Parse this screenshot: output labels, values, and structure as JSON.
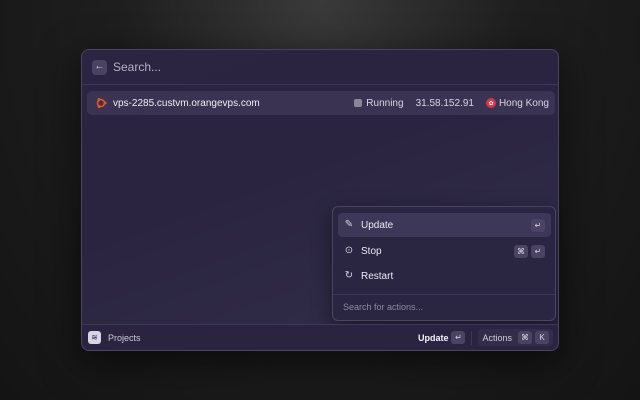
{
  "search": {
    "placeholder": "Search..."
  },
  "server": {
    "name": "vps-2285.custvm.orangevps.com",
    "status": "Running",
    "ip": "31.58.152.91",
    "location": "Hong Kong"
  },
  "actions_panel": {
    "items": [
      {
        "label": "Update",
        "icon": "pencil-icon",
        "shortcut": [
          "↵"
        ]
      },
      {
        "label": "Stop",
        "icon": "stop-circle-icon",
        "shortcut": [
          "⌘",
          "↵"
        ]
      },
      {
        "label": "Restart",
        "icon": "restart-icon",
        "shortcut": []
      }
    ],
    "search_placeholder": "Search for actions..."
  },
  "footer": {
    "section": "Projects",
    "primary_action": "Update",
    "primary_key": "↵",
    "actions_label": "Actions",
    "actions_keys": [
      "⌘",
      "K"
    ]
  },
  "colors": {
    "accent_ubuntu": "#e95420",
    "flag_red": "#d8344a",
    "panel_bg": "#2a2540"
  }
}
